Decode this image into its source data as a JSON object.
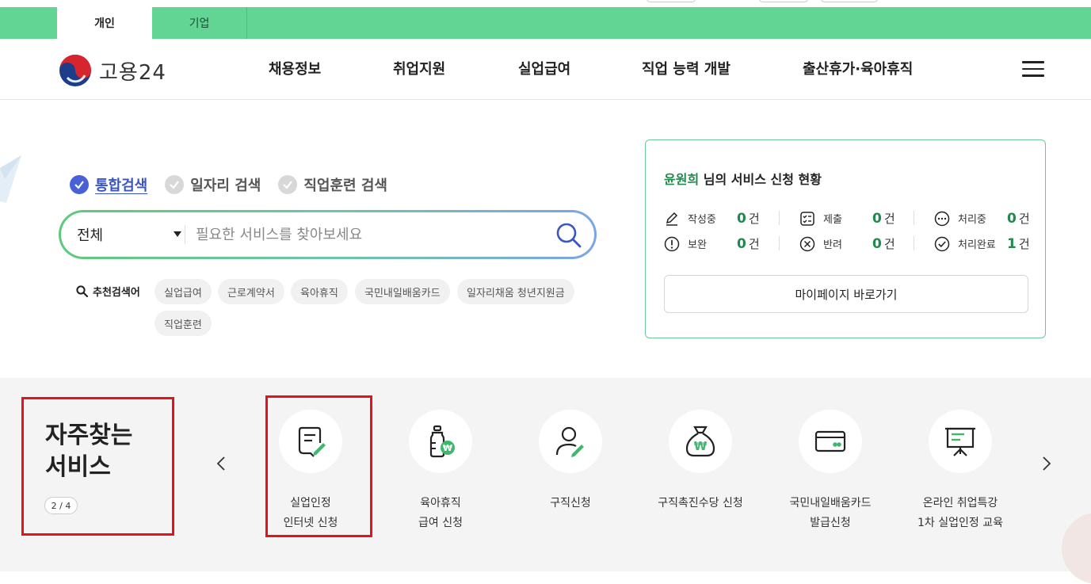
{
  "topbar": {
    "tabs": [
      {
        "label": "개인",
        "active": true
      },
      {
        "label": "기업",
        "active": false
      }
    ]
  },
  "header": {
    "logo_text": "고용24",
    "nav": [
      "채용정보",
      "취업지원",
      "실업급여",
      "직업 능력 개발",
      "출산휴가·육아휴직"
    ]
  },
  "search": {
    "types": [
      {
        "label": "통합검색",
        "active": true
      },
      {
        "label": "일자리 검색",
        "active": false
      },
      {
        "label": "직업훈련 검색",
        "active": false
      }
    ],
    "scope_value": "전체",
    "placeholder": "필요한 서비스를 찾아보세요",
    "recommend_label": "추천검색어",
    "keywords": [
      "실업급여",
      "근로계약서",
      "육아휴직",
      "국민내일배움카드",
      "일자리채움 청년지원금",
      "직업훈련"
    ]
  },
  "status": {
    "user_name": "윤원희",
    "title_suffix": " 님의 서비스 신청 현황",
    "items": [
      {
        "label": "작성중",
        "count": "0",
        "unit": "건",
        "icon": "pencil-icon"
      },
      {
        "label": "제출",
        "count": "0",
        "unit": "건",
        "icon": "checklist-icon"
      },
      {
        "label": "처리중",
        "count": "0",
        "unit": "건",
        "icon": "dots-circle-icon"
      },
      {
        "label": "보완",
        "count": "0",
        "unit": "건",
        "icon": "exclamation-circle-icon"
      },
      {
        "label": "반려",
        "count": "0",
        "unit": "건",
        "icon": "x-circle-icon"
      },
      {
        "label": "처리완료",
        "count": "1",
        "unit": "건",
        "icon": "check-circle-icon"
      }
    ],
    "mypage_button": "마이페이지 바로가기"
  },
  "frequent": {
    "title_line1": "자주찾는",
    "title_line2": "서비스",
    "pager": "2 / 4",
    "services": [
      {
        "label": "실업인정\n인터넷 신청",
        "icon": "document-pen-icon"
      },
      {
        "label": "육아휴직\n급여 신청",
        "icon": "baby-bottle-icon"
      },
      {
        "label": "구직신청",
        "icon": "person-pen-icon"
      },
      {
        "label": "구직촉진수당 신청",
        "icon": "money-bag-icon"
      },
      {
        "label": "국민내일배움카드\n발급신청",
        "icon": "card-icon"
      },
      {
        "label": "온라인 취업특강\n1차 실업인정 교육",
        "icon": "presentation-board-icon"
      }
    ]
  },
  "colors": {
    "brand_green": "#62d595",
    "accent_blue": "#4a60d6",
    "count_green": "#1f8a4c",
    "highlight_red": "#e0141a"
  }
}
